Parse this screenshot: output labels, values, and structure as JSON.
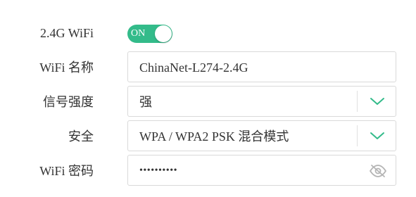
{
  "wifi_toggle": {
    "label": "2.4G WiFi",
    "state_text": "ON",
    "on": true,
    "color": "#33bb8a"
  },
  "wifi_name": {
    "label": "WiFi 名称",
    "value": "ChinaNet-L274-2.4G"
  },
  "signal_strength": {
    "label": "信号强度",
    "value": "强",
    "icon": "chevron-down-icon",
    "icon_color": "#33bb8a"
  },
  "security": {
    "label": "安全",
    "value": "WPA / WPA2 PSK 混合模式",
    "icon": "chevron-down-icon",
    "icon_color": "#33bb8a"
  },
  "wifi_password": {
    "label": "WiFi 密码",
    "value": "••••••••••",
    "icon": "eye-off-icon"
  }
}
